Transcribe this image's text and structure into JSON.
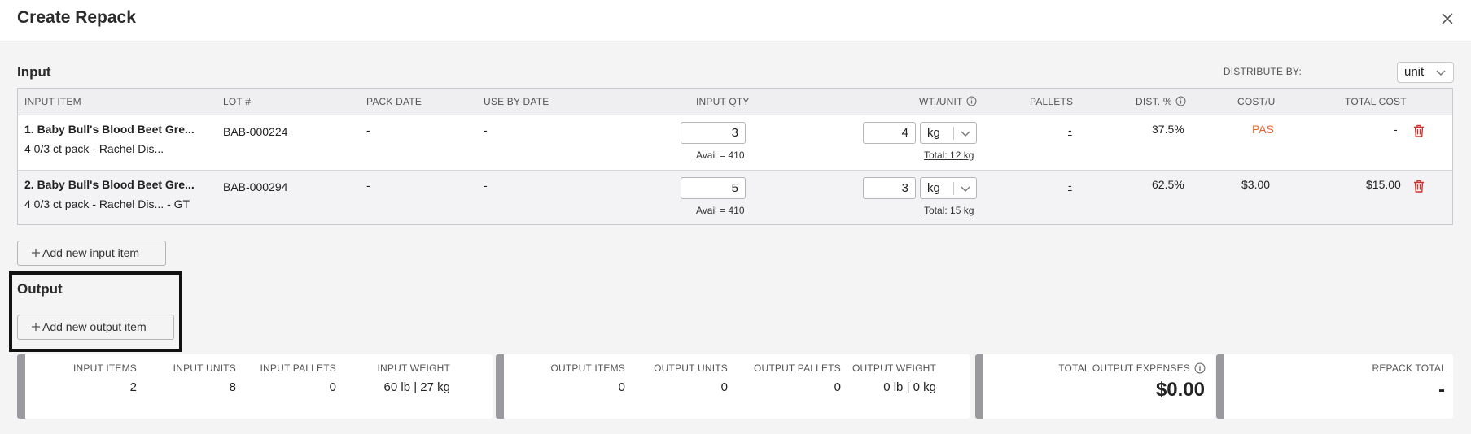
{
  "dialog": {
    "title": "Create Repack"
  },
  "input_section": {
    "title": "Input",
    "distribute_by_label": "DISTRIBUTE BY:",
    "distribute_by_value": "unit",
    "columns": [
      "INPUT ITEM",
      "LOT #",
      "PACK DATE",
      "USE BY DATE",
      "INPUT QTY",
      "WT./UNIT",
      "PALLETS",
      "DIST. %",
      "COST/U",
      "TOTAL COST"
    ],
    "rows": [
      {
        "item_name": "1. Baby Bull's Blood Beet Gre...",
        "item_desc": "4 0/3 ct pack - Rachel Dis...",
        "lot": "BAB-000224",
        "pack_date": "-",
        "use_by": "-",
        "qty": "3",
        "avail": "Avail = 410",
        "wt": "4",
        "wt_unit": "kg",
        "wt_total": "Total: 12 kg",
        "pallets": "-",
        "dist_pct": "37.5%",
        "cost_u": "PAS",
        "total_cost": "-"
      },
      {
        "item_name": "2. Baby Bull's Blood Beet Gre...",
        "item_desc": "4 0/3 ct pack - Rachel Dis... - GT",
        "lot": "BAB-000294",
        "pack_date": "-",
        "use_by": "-",
        "qty": "5",
        "avail": "Avail = 410",
        "wt": "3",
        "wt_unit": "kg",
        "wt_total": "Total: 15 kg",
        "pallets": "-",
        "dist_pct": "62.5%",
        "cost_u": "$3.00",
        "total_cost": "$15.00"
      }
    ],
    "add_button": "Add new input item"
  },
  "output_section": {
    "title": "Output",
    "add_button": "Add new output item"
  },
  "summary": {
    "input": [
      {
        "label": "INPUT ITEMS",
        "value": "2"
      },
      {
        "label": "INPUT UNITS",
        "value": "8"
      },
      {
        "label": "INPUT PALLETS",
        "value": "0"
      },
      {
        "label": "INPUT WEIGHT",
        "value": "60 lb | 27 kg"
      }
    ],
    "output": [
      {
        "label": "OUTPUT ITEMS",
        "value": "0"
      },
      {
        "label": "OUTPUT UNITS",
        "value": "0"
      },
      {
        "label": "OUTPUT PALLETS",
        "value": "0"
      },
      {
        "label": "OUTPUT WEIGHT",
        "value": "0 lb | 0 kg"
      }
    ],
    "expenses": {
      "label": "TOTAL OUTPUT EXPENSES",
      "value": "$0.00"
    },
    "repack_total": {
      "label": "REPACK TOTAL",
      "value": "-"
    }
  },
  "colors": {
    "accent_orange": "#e8632b",
    "delete_red": "#d0342c",
    "card_bar": "#9a9a9e"
  },
  "icons": [
    "close-icon",
    "info-icon",
    "chevron-down-icon",
    "trash-icon",
    "plus-icon"
  ]
}
